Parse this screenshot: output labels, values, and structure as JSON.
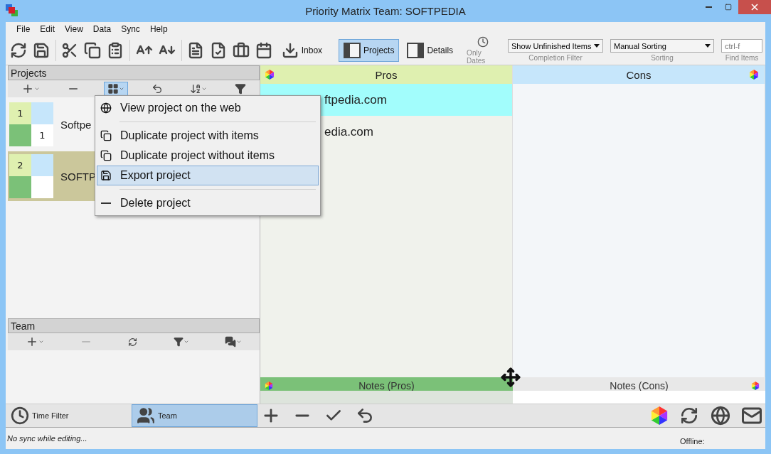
{
  "window": {
    "title": "Priority Matrix Team: SOFTPEDIA"
  },
  "menu": [
    "File",
    "Edit",
    "View",
    "Data",
    "Sync",
    "Help"
  ],
  "toolbar": {
    "inbox": "Inbox",
    "views": [
      {
        "label": "Projects",
        "selected": true
      },
      {
        "label": "Details",
        "selected": false
      }
    ],
    "only_dates": "Only Dates",
    "completion_filter": {
      "value": "Show Unfinished Items",
      "caption": "Completion Filter"
    },
    "sorting": {
      "value": "Manual Sorting",
      "caption": "Sorting"
    },
    "find": {
      "placeholder": "ctrl-f",
      "caption": "Find Items"
    }
  },
  "projects_panel": {
    "title": "Projects",
    "projects": [
      {
        "name": "Softpe",
        "counts": [
          "1",
          "1"
        ],
        "selected": false
      },
      {
        "name": "SOFTP",
        "counts": [
          "2"
        ],
        "selected": true
      }
    ]
  },
  "context_menu": {
    "items": [
      {
        "kind": "item",
        "label": "View project on the web",
        "selected": false
      },
      {
        "kind": "separator"
      },
      {
        "kind": "item",
        "label": "Duplicate project with items",
        "selected": false
      },
      {
        "kind": "item",
        "label": "Duplicate project without items",
        "selected": false
      },
      {
        "kind": "item",
        "label": "Export project",
        "selected": true
      },
      {
        "kind": "separator"
      },
      {
        "kind": "item",
        "label": "Delete project",
        "selected": false
      }
    ]
  },
  "team_panel": {
    "title": "Team"
  },
  "bottom_tabs": [
    {
      "label": "Time Filter",
      "selected": false
    },
    {
      "label": "Team",
      "selected": true
    }
  ],
  "quadrants": [
    {
      "title": "Pros",
      "items": [
        {
          "text": "ftpedia.com",
          "selected": true
        },
        {
          "text": "edia.com",
          "selected": false
        }
      ]
    },
    {
      "title": "Cons"
    }
  ],
  "notes": [
    "Notes (Pros)",
    "Notes (Cons)"
  ],
  "status": {
    "message": "No sync while editing...",
    "offline": "Offline:"
  }
}
